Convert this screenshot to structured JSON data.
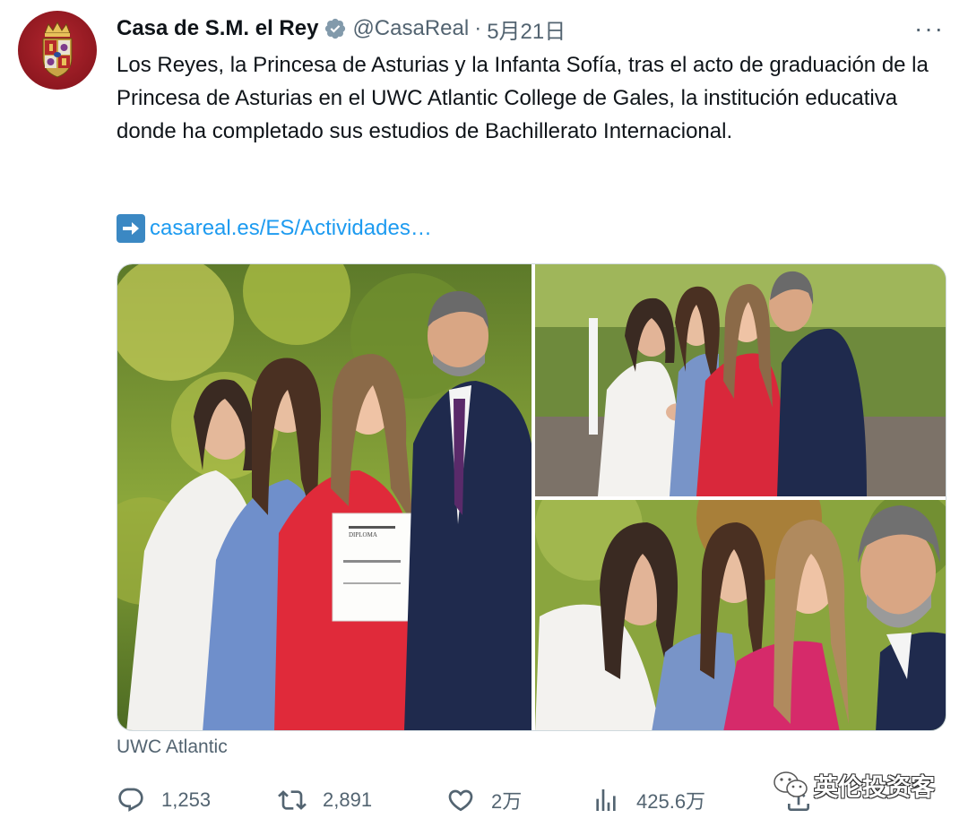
{
  "account": {
    "name": "Casa de S.M. el Rey",
    "handle": "@CasaReal",
    "separator": "·",
    "date": "5月21日",
    "avatar_icon": "royal-coat-of-arms-icon",
    "verified_icon": "verified-badge-icon",
    "verified_color": "#829aab"
  },
  "more_label": "···",
  "tweet": {
    "text": "Los Reyes, la Princesa de Asturias y la Infanta Sofía, tras el acto de graduación de la Princesa de Asturias en el UWC Atlantic College de Gales, la institución educativa donde ha completado sus estudios de Bachillerato Internacional.",
    "link_icon": "right-arrow-emoji-icon",
    "link_text": "casareal.es/ES/Actividades…"
  },
  "media": {
    "photos": [
      {
        "name": "graduation-group-photo",
        "icon": "photo-icon"
      },
      {
        "name": "selfie-photo-garden",
        "icon": "photo-icon"
      },
      {
        "name": "selfie-photo-closeup",
        "icon": "photo-icon"
      }
    ],
    "diploma_label": "DIPLOMA"
  },
  "location": "UWC Atlantic",
  "actions": {
    "reply_count": "1,253",
    "retweet_count": "2,891",
    "like_count": "2万",
    "view_count": "425.6万"
  },
  "watermark": {
    "text": "英伦投资客",
    "icon": "wechat-icon"
  },
  "colors": {
    "text_primary": "#0f1419",
    "text_secondary": "#536471",
    "link": "#1d9bf0",
    "border": "#cfd9de",
    "avatar_red": "#8f1820"
  }
}
